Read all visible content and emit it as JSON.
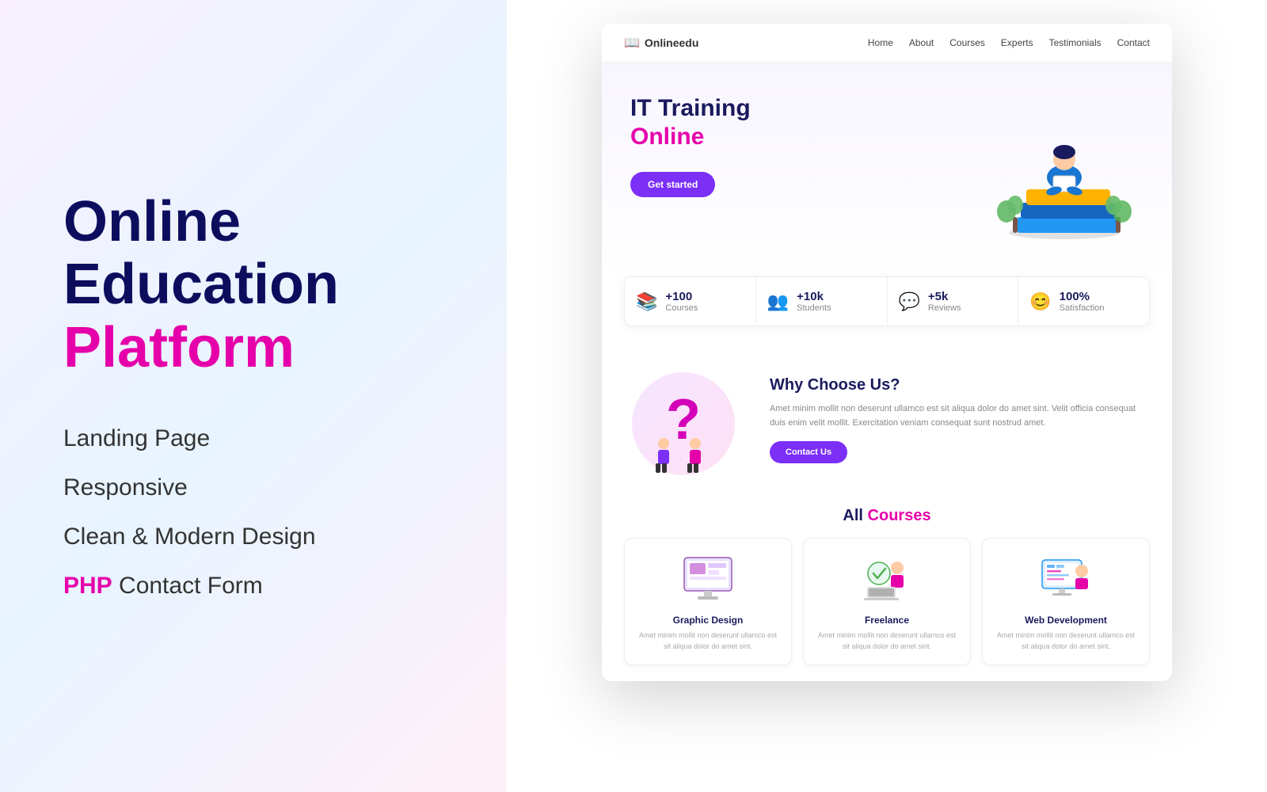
{
  "left": {
    "title_line1": "Online",
    "title_line2": "Education",
    "title_platform": "Platform",
    "features": [
      {
        "text": "Landing Page",
        "pink": ""
      },
      {
        "text": "Responsive",
        "pink": ""
      },
      {
        "text": "Clean & Modern Design",
        "pink": ""
      },
      {
        "text": " Contact Form",
        "pink": "PHP"
      }
    ]
  },
  "nav": {
    "logo": "Onlineedu",
    "links": [
      "Home",
      "About",
      "Courses",
      "Experts",
      "Testimonials",
      "Contact"
    ]
  },
  "hero": {
    "title_line1": "IT Training",
    "title_line2": "Online",
    "cta_button": "Get started"
  },
  "stats": [
    {
      "number": "+100",
      "label": "Courses",
      "icon": "📚"
    },
    {
      "number": "+10k",
      "label": "Students",
      "icon": "👥"
    },
    {
      "number": "+5k",
      "label": "Reviews",
      "icon": "💬"
    },
    {
      "number": "100%",
      "label": "Satisfaction",
      "icon": "😊"
    }
  ],
  "why": {
    "title": "Why Choose Us?",
    "description": "Amet minim mollit non deserunt ullamco est sit aliqua dolor do amet sint. Velit officia consequat duis enim velit mollit. Exercitation veniam consequat sunt nostrud amet.",
    "cta_button": "Contact Us"
  },
  "courses": {
    "title_plain": "All ",
    "title_pink": "Courses",
    "cards": [
      {
        "name": "Graphic Design",
        "desc": "Amet minim mollit non deserunt ullamco est sit aliqua dolor do amet sint."
      },
      {
        "name": "Freelance",
        "desc": "Amet minim mollit non deserunt ullamco est sit aliqua dolor do amet sint."
      },
      {
        "name": "Web Development",
        "desc": "Amet minim mollit non deserunt ullamco est sit aliqua dolor do amet sint."
      }
    ]
  },
  "colors": {
    "purple": "#7b2ff7",
    "pink": "#e600aa",
    "dark_navy": "#1a1a5e"
  }
}
